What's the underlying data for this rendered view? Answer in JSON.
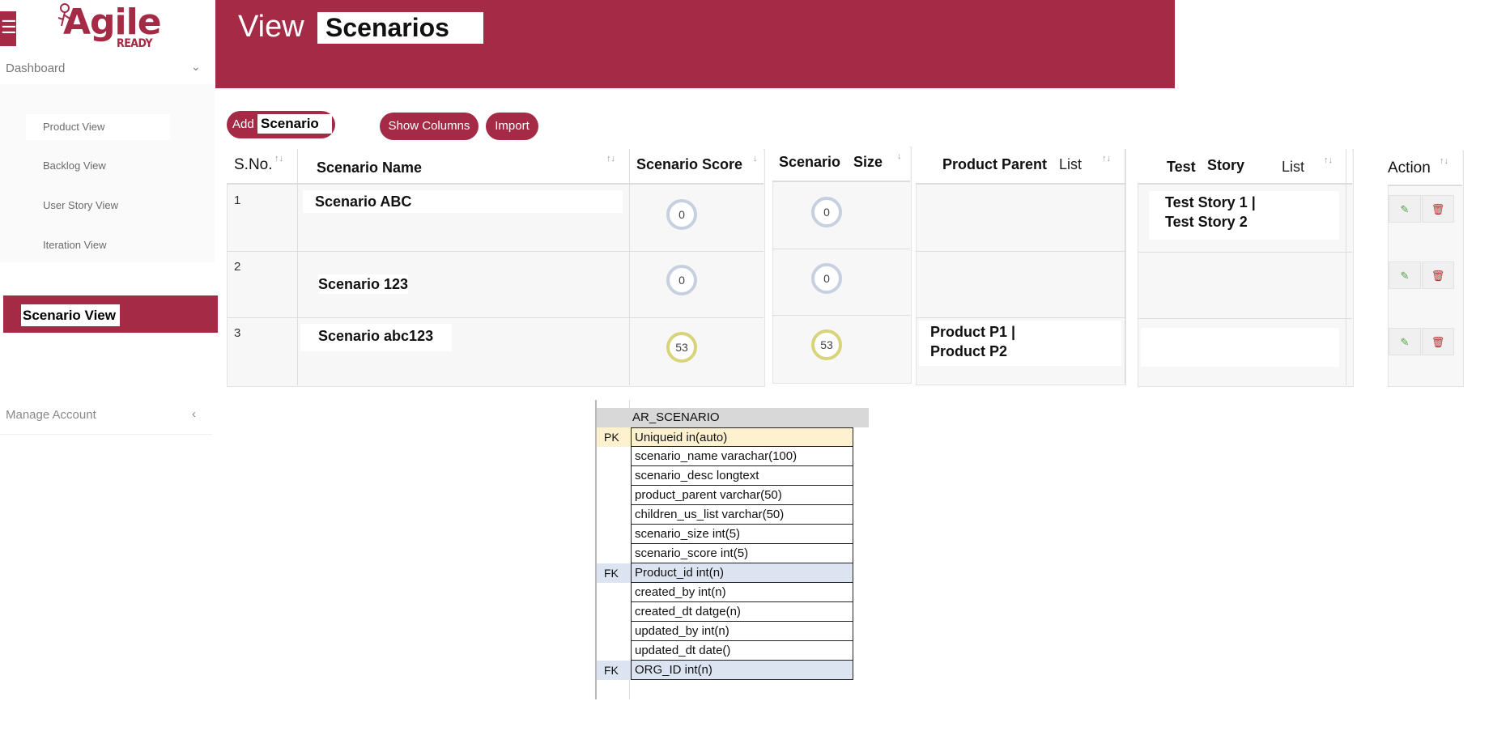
{
  "app": {
    "logo_word": "Agile",
    "logo_sub": "READY",
    "menu_icon": "hamburger-icon"
  },
  "sidebar": {
    "dashboard": "Dashboard",
    "items": [
      {
        "label": "Product View"
      },
      {
        "label": "Backlog View"
      },
      {
        "label": "User Story View"
      },
      {
        "label": "Iteration View"
      }
    ],
    "active": "Scenario View",
    "manage": "Manage Account"
  },
  "header": {
    "view_word": "View",
    "view_name": "Scenarios"
  },
  "toolbar": {
    "add_word": "Add",
    "add_scenario": "Scenario",
    "show_columns": "Show Columns",
    "import": "Import"
  },
  "table": {
    "headers": {
      "sno": "S.No.",
      "name": "Scenario Name",
      "score": "Scenario Score",
      "size_a": "Scenario",
      "size_b": "Size",
      "parent_a": "Product Parent",
      "parent_b": "List",
      "story_a": "Test",
      "story_b": "Story",
      "story_c": "List",
      "action": "Action"
    },
    "rows": [
      {
        "sno": "1",
        "name": "Scenario ABC",
        "score": "0",
        "size": "0",
        "parent_1": "",
        "parent_2": "",
        "story_1": "Test Story 1 |",
        "story_2": "Test Story 2"
      },
      {
        "sno": "2",
        "name": "Scenario 123",
        "score": "0",
        "size": "0",
        "parent_1": "",
        "parent_2": "",
        "story_1": "",
        "story_2": ""
      },
      {
        "sno": "3",
        "name": "Scenario abc123",
        "score": "53",
        "size": "53",
        "parent_1": "Product P1 |",
        "parent_2": "Product P2",
        "story_1": "",
        "story_2": ""
      }
    ]
  },
  "db_table": {
    "title": "AR_SCENARIO",
    "fields": [
      {
        "key": "PK",
        "name": "Uniqueid in(auto)"
      },
      {
        "key": "",
        "name": "scenario_name varachar(100)"
      },
      {
        "key": "",
        "name": "scenario_desc longtext"
      },
      {
        "key": "",
        "name": "product_parent varchar(50)"
      },
      {
        "key": "",
        "name": "children_us_list varchar(50)"
      },
      {
        "key": "",
        "name": "scenario_size int(5)"
      },
      {
        "key": "",
        "name": "scenario_score int(5)"
      },
      {
        "key": "FK",
        "name": "Product_id int(n)"
      },
      {
        "key": "",
        "name": "created_by int(n)"
      },
      {
        "key": "",
        "name": "created_dt datge(n)"
      },
      {
        "key": "",
        "name": "updated_by int(n)"
      },
      {
        "key": "",
        "name": "updated_dt date()"
      },
      {
        "key": "FK",
        "name": "ORG_ID int(n)"
      }
    ]
  },
  "colors": {
    "brand": "#a42a45",
    "pk": "#fdf1d0",
    "fk": "#dce4f2",
    "ring_zero": "#c8d0e0",
    "ring_mid": "#d9d37a"
  }
}
